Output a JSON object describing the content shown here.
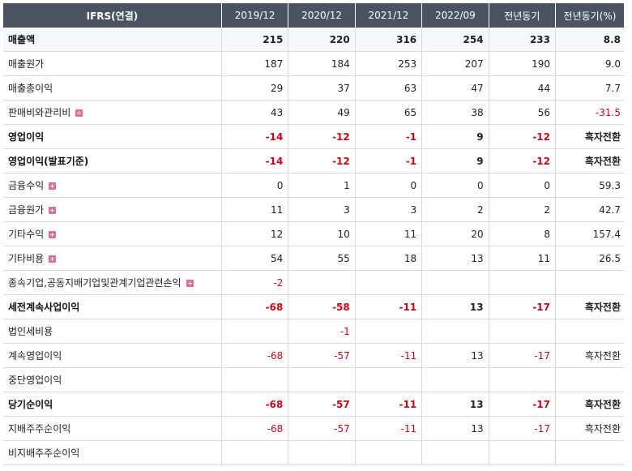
{
  "header": {
    "label": "IFRS(연결)",
    "periods": [
      "2019/12",
      "2020/12",
      "2021/12",
      "2022/09",
      "전년동기",
      "전년동기(%)"
    ]
  },
  "rows": [
    {
      "label": "매출액",
      "values": [
        "215",
        "220",
        "316",
        "254",
        "233",
        "8.8"
      ],
      "bold": true,
      "expand": false,
      "neg": [
        false,
        false,
        false,
        false,
        false,
        false
      ]
    },
    {
      "label": "매출원가",
      "values": [
        "187",
        "184",
        "253",
        "207",
        "190",
        "9.0"
      ],
      "bold": false,
      "expand": false,
      "neg": [
        false,
        false,
        false,
        false,
        false,
        false
      ]
    },
    {
      "label": "매출총이익",
      "values": [
        "29",
        "37",
        "63",
        "47",
        "44",
        "7.7"
      ],
      "bold": false,
      "expand": false,
      "neg": [
        false,
        false,
        false,
        false,
        false,
        false
      ]
    },
    {
      "label": "판매비와관리비",
      "values": [
        "43",
        "49",
        "65",
        "38",
        "56",
        "-31.5"
      ],
      "bold": false,
      "expand": true,
      "neg": [
        false,
        false,
        false,
        false,
        false,
        true
      ]
    },
    {
      "label": "영업이익",
      "values": [
        "-14",
        "-12",
        "-1",
        "9",
        "-12",
        "흑자전환"
      ],
      "bold": true,
      "expand": false,
      "neg": [
        true,
        true,
        true,
        false,
        true,
        false
      ]
    },
    {
      "label": "영업이익(발표기준)",
      "values": [
        "-14",
        "-12",
        "-1",
        "9",
        "-12",
        "흑자전환"
      ],
      "bold": true,
      "expand": false,
      "neg": [
        true,
        true,
        true,
        false,
        true,
        false
      ]
    },
    {
      "label": "금융수익",
      "values": [
        "0",
        "1",
        "0",
        "0",
        "0",
        "59.3"
      ],
      "bold": false,
      "expand": true,
      "neg": [
        false,
        false,
        false,
        false,
        false,
        false
      ]
    },
    {
      "label": "금융원가",
      "values": [
        "11",
        "3",
        "3",
        "2",
        "2",
        "42.7"
      ],
      "bold": false,
      "expand": true,
      "neg": [
        false,
        false,
        false,
        false,
        false,
        false
      ]
    },
    {
      "label": "기타수익",
      "values": [
        "12",
        "10",
        "11",
        "20",
        "8",
        "157.4"
      ],
      "bold": false,
      "expand": true,
      "neg": [
        false,
        false,
        false,
        false,
        false,
        false
      ]
    },
    {
      "label": "기타비용",
      "values": [
        "54",
        "55",
        "18",
        "13",
        "11",
        "26.5"
      ],
      "bold": false,
      "expand": true,
      "neg": [
        false,
        false,
        false,
        false,
        false,
        false
      ]
    },
    {
      "label": "종속기업,공동지배기업및관계기업관련손익",
      "values": [
        "-2",
        "",
        "",
        "",
        "",
        ""
      ],
      "bold": false,
      "expand": true,
      "neg": [
        true,
        false,
        false,
        false,
        false,
        false
      ]
    },
    {
      "label": "세전계속사업이익",
      "values": [
        "-68",
        "-58",
        "-11",
        "13",
        "-17",
        "흑자전환"
      ],
      "bold": true,
      "expand": false,
      "neg": [
        true,
        true,
        true,
        false,
        true,
        false
      ]
    },
    {
      "label": "법인세비용",
      "values": [
        "",
        "-1",
        "",
        "",
        "",
        ""
      ],
      "bold": false,
      "expand": false,
      "neg": [
        false,
        true,
        false,
        false,
        false,
        false
      ]
    },
    {
      "label": "계속영업이익",
      "values": [
        "-68",
        "-57",
        "-11",
        "13",
        "-17",
        "흑자전환"
      ],
      "bold": false,
      "expand": false,
      "neg": [
        true,
        true,
        true,
        false,
        true,
        false
      ]
    },
    {
      "label": "중단영업이익",
      "values": [
        "",
        "",
        "",
        "",
        "",
        ""
      ],
      "bold": false,
      "expand": false,
      "neg": [
        false,
        false,
        false,
        false,
        false,
        false
      ]
    },
    {
      "label": "당기순이익",
      "values": [
        "-68",
        "-57",
        "-11",
        "13",
        "-17",
        "흑자전환"
      ],
      "bold": true,
      "expand": false,
      "neg": [
        true,
        true,
        true,
        false,
        true,
        false
      ]
    },
    {
      "label": "지배주주순이익",
      "values": [
        "-68",
        "-57",
        "-11",
        "13",
        "-17",
        "흑자전환"
      ],
      "bold": false,
      "expand": false,
      "indent": true,
      "neg": [
        true,
        true,
        true,
        false,
        true,
        false
      ]
    },
    {
      "label": "비지배주주순이익",
      "values": [
        "",
        "",
        "",
        "",
        "",
        ""
      ],
      "bold": false,
      "expand": false,
      "indent": true,
      "neg": [
        false,
        false,
        false,
        false,
        false,
        false
      ]
    }
  ]
}
